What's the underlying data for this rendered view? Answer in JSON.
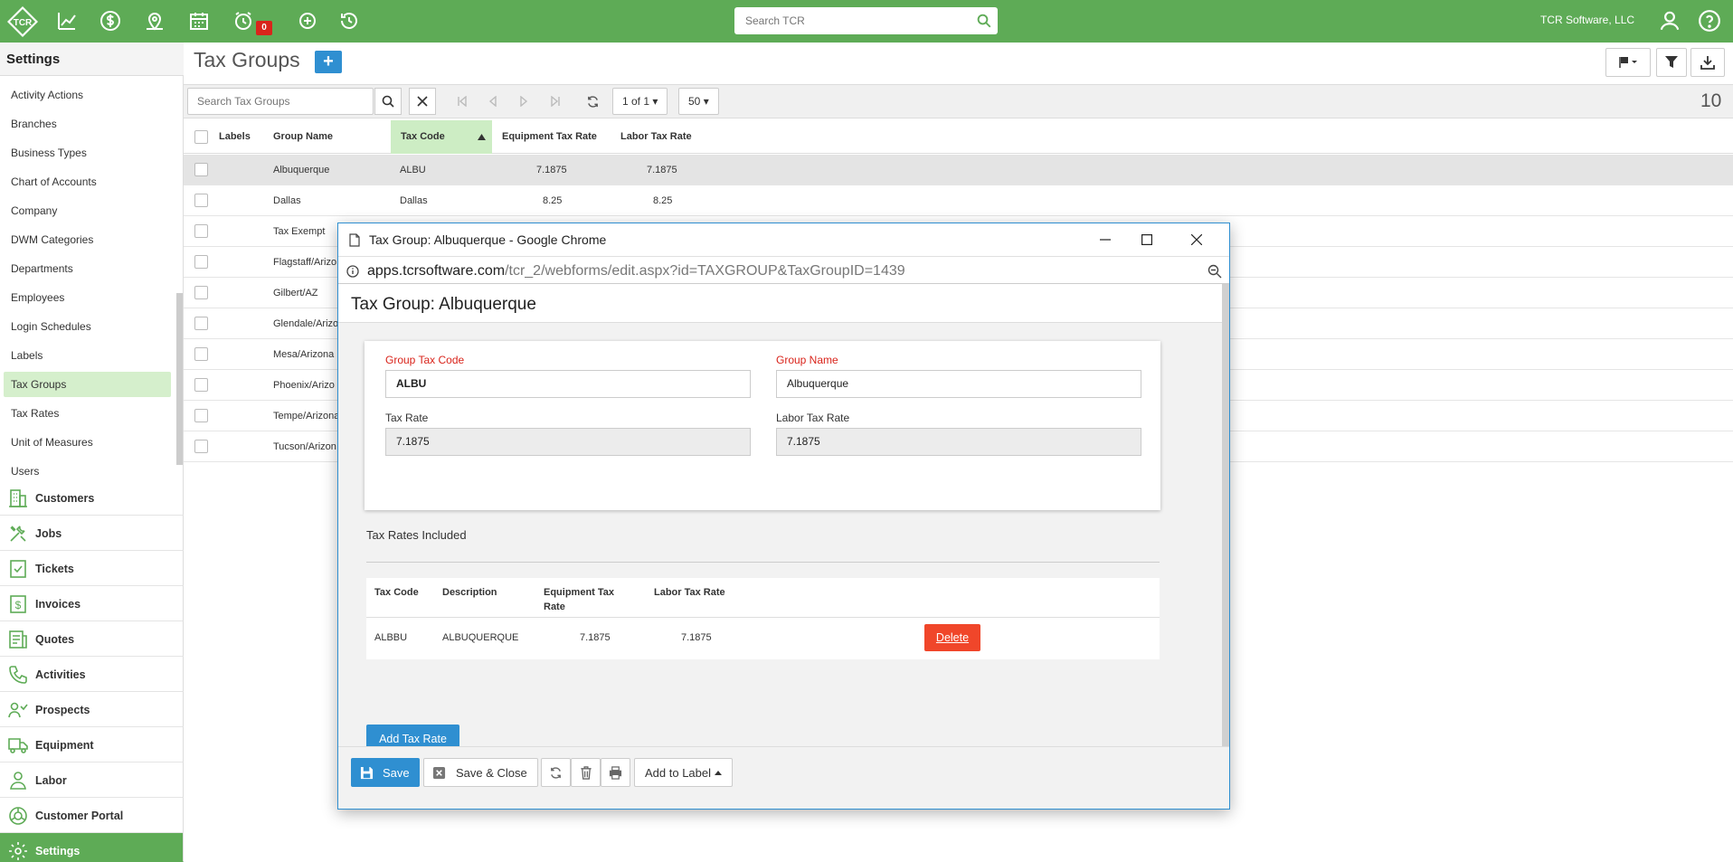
{
  "colors": {
    "brand_green": "#5eab56",
    "accent_blue": "#2f8fd1",
    "danger": "#f0462a",
    "active_item": "#d5efcc"
  },
  "topbar": {
    "logo_text": "TCR",
    "icons": [
      "logo-icon",
      "chart-icon",
      "dollar-icon",
      "map-pin-icon",
      "calendar-icon",
      "alarm-icon",
      "add-circle-icon",
      "history-icon"
    ],
    "alarm_count": "0",
    "search_placeholder": "Search TCR",
    "company": "TCR Software, LLC"
  },
  "sidebar": {
    "settings_title": "Settings",
    "settings_items": [
      {
        "label": "Activity Actions"
      },
      {
        "label": "Branches"
      },
      {
        "label": "Business Types"
      },
      {
        "label": "Chart of Accounts"
      },
      {
        "label": "Company"
      },
      {
        "label": "DWM Categories"
      },
      {
        "label": "Departments"
      },
      {
        "label": "Employees"
      },
      {
        "label": "Login Schedules"
      },
      {
        "label": "Labels"
      },
      {
        "label": "Tax Groups",
        "active": true
      },
      {
        "label": "Tax Rates"
      },
      {
        "label": "Unit of Measures"
      },
      {
        "label": "Users"
      }
    ],
    "nav": [
      {
        "label": "Customers",
        "icon": "building-icon"
      },
      {
        "label": "Jobs",
        "icon": "tools-icon"
      },
      {
        "label": "Tickets",
        "icon": "ticket-icon"
      },
      {
        "label": "Invoices",
        "icon": "invoice-icon"
      },
      {
        "label": "Quotes",
        "icon": "quote-icon"
      },
      {
        "label": "Activities",
        "icon": "phone-icon"
      },
      {
        "label": "Prospects",
        "icon": "prospect-icon"
      },
      {
        "label": "Equipment",
        "icon": "truck-icon"
      },
      {
        "label": "Labor",
        "icon": "person-icon"
      },
      {
        "label": "Customer Portal",
        "icon": "portal-icon"
      },
      {
        "label": "Settings",
        "icon": "gear-icon",
        "active": true
      }
    ]
  },
  "main": {
    "title": "Tax Groups",
    "add_symbol": "+",
    "search_placeholder": "Search Tax Groups",
    "page_label": "1 of 1",
    "page_size": "50",
    "total_count": "10",
    "columns": [
      "Labels",
      "Group Name",
      "Tax Code",
      "Equipment Tax Rate",
      "Labor Tax Rate"
    ],
    "rows": [
      {
        "name": "Albuquerque",
        "code": "ALBU",
        "equip": "7.1875",
        "labor": "7.1875",
        "selected": true
      },
      {
        "name": "Dallas",
        "code": "Dallas",
        "equip": "8.25",
        "labor": "8.25"
      },
      {
        "name": "Tax Exempt",
        "code": "",
        "equip": "",
        "labor": ""
      },
      {
        "name": "Flagstaff/Arizo",
        "code": "",
        "equip": "",
        "labor": ""
      },
      {
        "name": "Gilbert/AZ",
        "code": "",
        "equip": "",
        "labor": ""
      },
      {
        "name": "Glendale/Arizo",
        "code": "",
        "equip": "",
        "labor": ""
      },
      {
        "name": "Mesa/Arizona",
        "code": "",
        "equip": "",
        "labor": ""
      },
      {
        "name": "Phoenix/Arizo",
        "code": "",
        "equip": "",
        "labor": ""
      },
      {
        "name": "Tempe/Arizona",
        "code": "",
        "equip": "",
        "labor": ""
      },
      {
        "name": "Tucson/Arizon",
        "code": "",
        "equip": "",
        "labor": ""
      }
    ]
  },
  "popup": {
    "window_title": "Tax Group: Albuquerque - Google Chrome",
    "url_host": "apps.tcrsoftware.com",
    "url_path": "/tcr_2/webforms/edit.aspx?id=TAXGROUP&TaxGroupID=1439",
    "edit_title": "Tax Group: Albuquerque",
    "fields": {
      "group_tax_code_label": "Group Tax Code",
      "group_tax_code": "ALBU",
      "group_name_label": "Group Name",
      "group_name": "Albuquerque",
      "tax_rate_label": "Tax Rate",
      "tax_rate": "7.1875",
      "labor_tax_rate_label": "Labor Tax Rate",
      "labor_tax_rate": "7.1875"
    },
    "rates_section_title": "Tax Rates Included",
    "rates_columns": {
      "code": "Tax Code",
      "desc": "Description",
      "equip": "Equipment Tax Rate",
      "labor": "Labor Tax Rate"
    },
    "rates_rows": [
      {
        "code": "ALBBU",
        "desc": "ALBUQUERQUE",
        "equip": "7.1875",
        "labor": "7.1875",
        "action": "Delete"
      }
    ],
    "add_rate_label": "Add Tax Rate",
    "footer": {
      "save": "Save",
      "save_close": "Save & Close",
      "add_to_label": "Add to Label"
    }
  }
}
